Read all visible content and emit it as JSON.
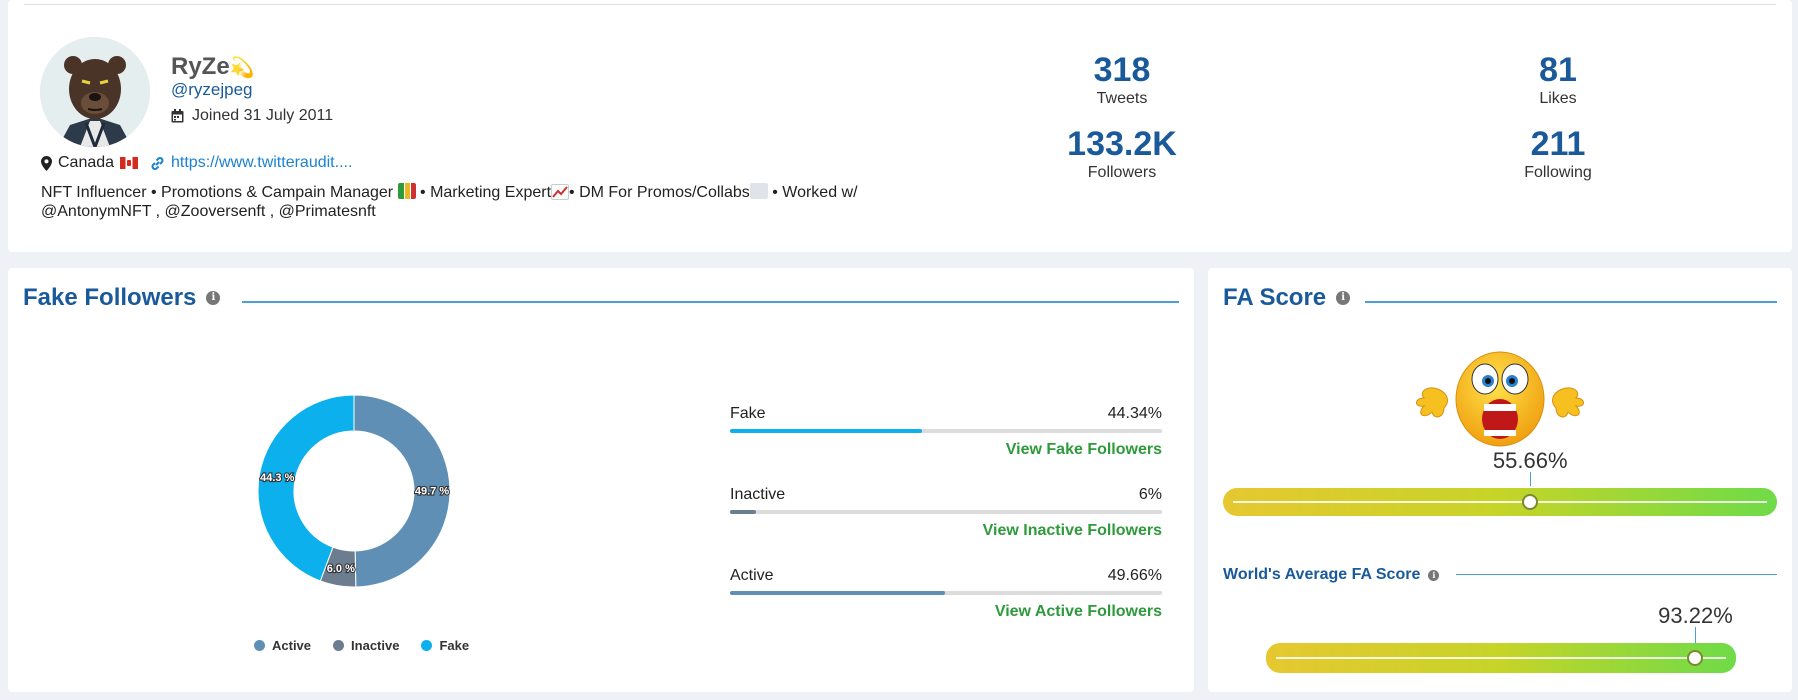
{
  "profile": {
    "name": "RyZe",
    "handle": "@ryzejpeg",
    "joined": "Joined 31 July 2011",
    "location": "Canada",
    "link": "https://www.twitteraudit....",
    "bio_line1": "NFT Influencer • Promotions & Campain Manager",
    "bio_line1b": "• Marketing Expert",
    "bio_line1c": "• DM For Promos/Collabs",
    "bio_line1d": "• Worked w/",
    "bio_line2": "@AntonymNFT , @Zooversenft , @Primatesnft"
  },
  "stats": {
    "tweets": {
      "value": "318",
      "label": "Tweets"
    },
    "likes": {
      "value": "81",
      "label": "Likes"
    },
    "followers": {
      "value": "133.2K",
      "label": "Followers"
    },
    "following": {
      "value": "211",
      "label": "Following"
    }
  },
  "fake_followers": {
    "title": "Fake Followers",
    "chart_data": {
      "type": "pie",
      "categories": [
        "Active",
        "Inactive",
        "Fake"
      ],
      "values": [
        49.7,
        6.0,
        44.3
      ],
      "labels": [
        "49.7 %",
        "6.0 %",
        "44.3 %"
      ],
      "colors": [
        "#5f8fb5",
        "#6b7d8e",
        "#0bb0ec"
      ],
      "legend_position": "bottom"
    },
    "legend": [
      {
        "label": "Active",
        "color": "#5f8fb5"
      },
      {
        "label": "Inactive",
        "color": "#6b7d8e"
      },
      {
        "label": "Fake",
        "color": "#0bb0ec"
      }
    ],
    "metrics": [
      {
        "label": "Fake",
        "value": "44.34%",
        "fraction": 0.4434,
        "color": "#0bb0ec",
        "link": "View Fake Followers"
      },
      {
        "label": "Inactive",
        "value": "6%",
        "fraction": 0.06,
        "color": "#6b7d8e",
        "link": "View Inactive Followers"
      },
      {
        "label": "Active",
        "value": "49.66%",
        "fraction": 0.4966,
        "color": "#5f8fb5",
        "link": "View Active Followers"
      }
    ]
  },
  "fa_score": {
    "title": "FA Score",
    "score": "55.66%",
    "score_fraction": 0.5566,
    "world_title": "World's Average FA Score",
    "world_score": "93.22%",
    "world_fraction": 0.9322
  }
}
